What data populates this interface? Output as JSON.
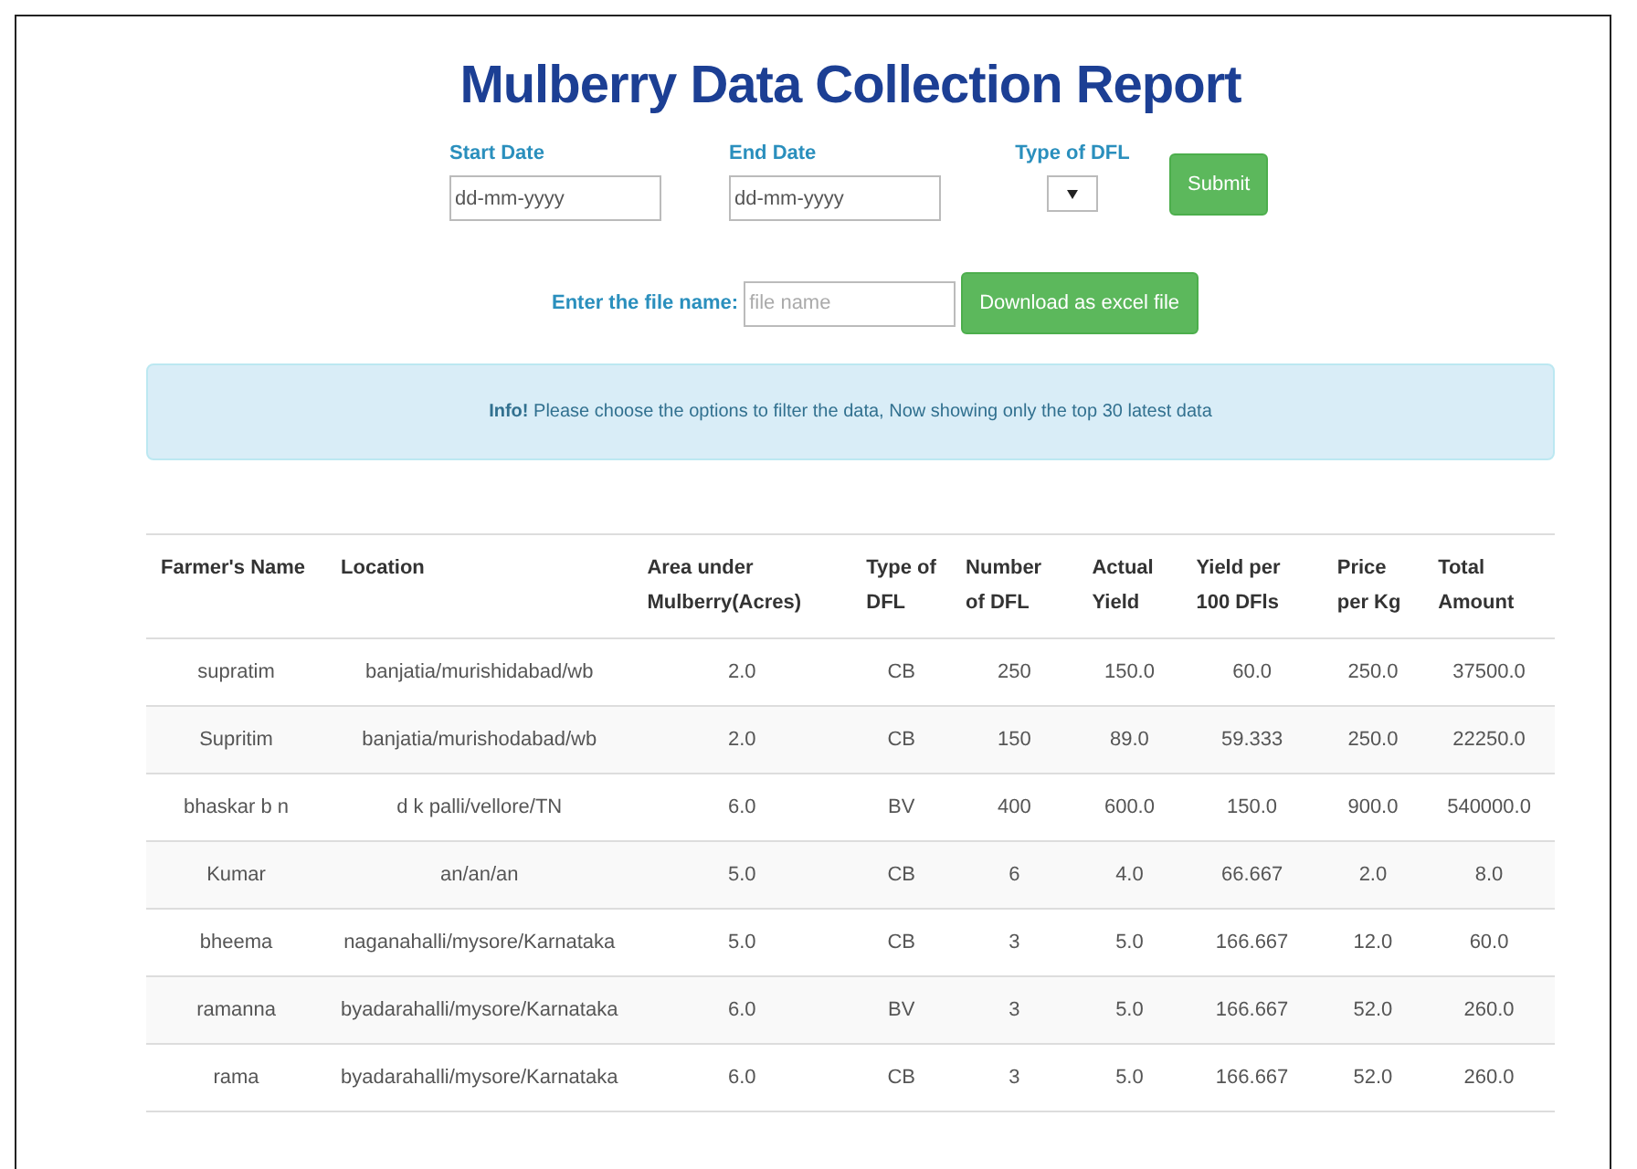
{
  "title": "Mulberry Data Collection Report",
  "filters": [
    {
      "kind": "date",
      "label": "Start Date",
      "placeholder": "dd-mm-yyyy"
    },
    {
      "kind": "date",
      "label": "End Date",
      "placeholder": "dd-mm-yyyy"
    },
    {
      "kind": "select",
      "label": "Type of DFL"
    }
  ],
  "submit_button": "Submit",
  "file_name": {
    "label": "Enter the file name:",
    "placeholder": "file name",
    "button": "Download as excel file"
  },
  "info": "**Info!** Please choose the options to filter the data, Now showing only the top 30 latest data",
  "table": {
    "columns": [
      "Farmer's Name",
      "Location",
      "Area under Mulberry(Acres)",
      "Type of DFL",
      "Number of DFL",
      "Actual Yield",
      "Yield per 100 DFls",
      "Price per Kg",
      "Total Amount"
    ],
    "rows": [
      [
        "supratim",
        "banjatia/murishidabad/wb",
        "2.0",
        "CB",
        "250",
        "150.0",
        "60.0",
        "250.0",
        "37500.0"
      ],
      [
        "Supritim",
        "banjatia/murishodabad/wb",
        "2.0",
        "CB",
        "150",
        "89.0",
        "59.333",
        "250.0",
        "22250.0"
      ],
      [
        "bhaskar b n",
        "d k palli/vellore/TN",
        "6.0",
        "BV",
        "400",
        "600.0",
        "150.0",
        "900.0",
        "540000.0"
      ],
      [
        "Kumar",
        "an/an/an",
        "5.0",
        "CB",
        "6",
        "4.0",
        "66.667",
        "2.0",
        "8.0"
      ],
      [
        "bheema",
        "naganahalli/mysore/Karnataka",
        "5.0",
        "CB",
        "3",
        "5.0",
        "166.667",
        "12.0",
        "60.0"
      ],
      [
        "ramanna",
        "byadarahalli/mysore/Karnataka",
        "6.0",
        "BV",
        "3",
        "5.0",
        "166.667",
        "52.0",
        "260.0"
      ],
      [
        "rama",
        "byadarahalli/mysore/Karnataka",
        "6.0",
        "CB",
        "3",
        "5.0",
        "166.667",
        "52.0",
        "260.0"
      ]
    ]
  }
}
